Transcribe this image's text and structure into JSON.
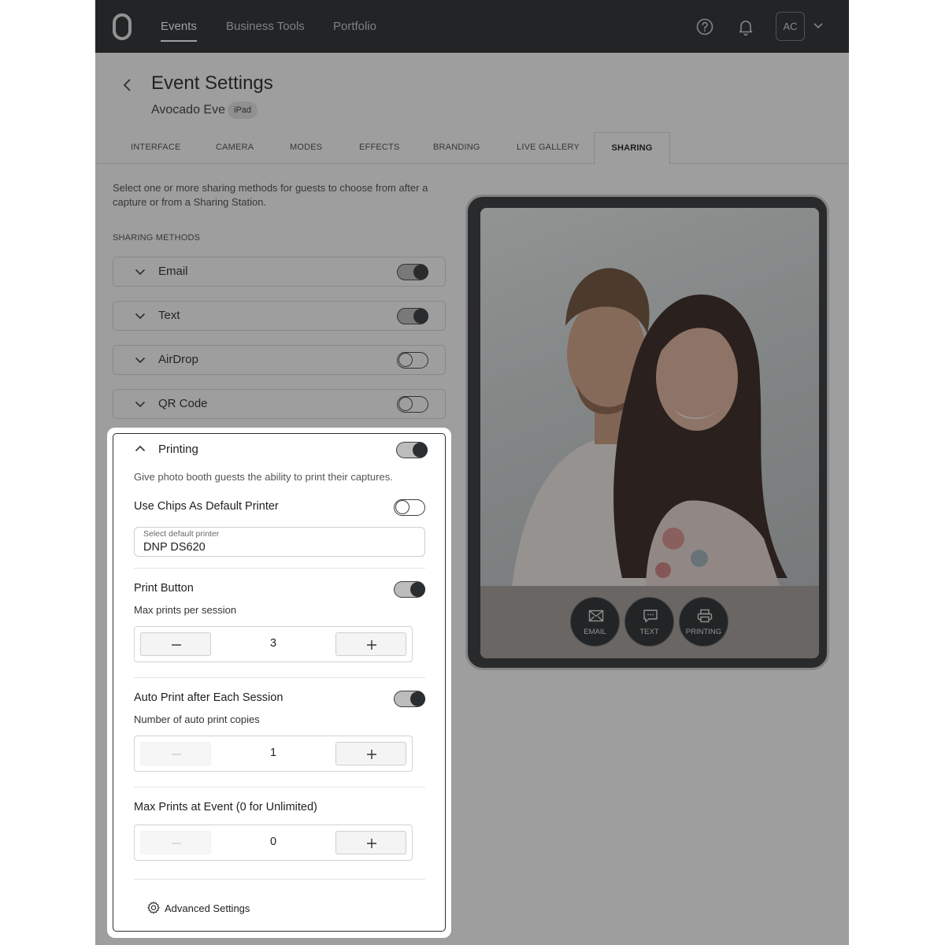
{
  "nav": {
    "items": [
      {
        "label": "Events",
        "active": true
      },
      {
        "label": "Business Tools",
        "active": false
      },
      {
        "label": "Portfolio",
        "active": false
      }
    ],
    "help_icon": "question-circle-icon",
    "notifications_icon": "bell-icon",
    "avatar_initials": "AC"
  },
  "header": {
    "title": "Event Settings",
    "event_name": "Avocado Eve",
    "device_badge": "iPad"
  },
  "tabs": [
    {
      "label": "INTERFACE",
      "active": false
    },
    {
      "label": "CAMERA",
      "active": false
    },
    {
      "label": "MODES",
      "active": false
    },
    {
      "label": "EFFECTS",
      "active": false
    },
    {
      "label": "BRANDING",
      "active": false
    },
    {
      "label": "LIVE GALLERY",
      "active": false
    },
    {
      "label": "SHARING",
      "active": true
    }
  ],
  "sharing": {
    "intro": "Select one or more sharing methods for guests to choose from after a capture or from a Sharing Station.",
    "section_label": "SHARING METHODS",
    "methods": [
      {
        "label": "Email",
        "enabled": true
      },
      {
        "label": "Text",
        "enabled": true
      },
      {
        "label": "AirDrop",
        "enabled": false
      },
      {
        "label": "QR Code",
        "enabled": false
      }
    ],
    "printing": {
      "label": "Printing",
      "enabled": true,
      "description": "Give photo booth guests the ability to print their captures.",
      "use_chips_label": "Use Chips As Default Printer",
      "use_chips_enabled": false,
      "printer_caption": "Select default printer",
      "printer_value": "DNP DS620",
      "print_button_label": "Print Button",
      "print_button_enabled": true,
      "max_prints_label": "Max prints per session",
      "max_prints_value": "3",
      "auto_print_label": "Auto Print after Each Session",
      "auto_print_enabled": true,
      "auto_copies_label": "Number of auto print copies",
      "auto_copies_value": "1",
      "max_event_label": "Max Prints at Event (0 for Unlimited)",
      "max_event_value": "0",
      "advanced_label": "Advanced Settings"
    }
  },
  "preview": {
    "buttons": [
      {
        "label": "EMAIL",
        "icon": "envelope-icon"
      },
      {
        "label": "TEXT",
        "icon": "chat-bubble-icon"
      },
      {
        "label": "PRINTING",
        "icon": "printer-icon"
      }
    ]
  }
}
